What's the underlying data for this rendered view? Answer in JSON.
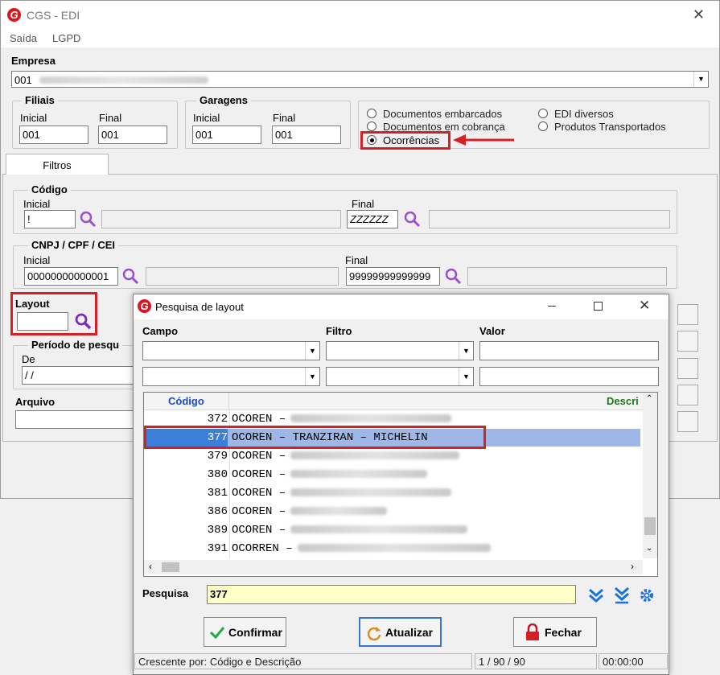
{
  "window": {
    "title": "CGS - EDI",
    "close": "✕"
  },
  "menu": [
    "Saída",
    "LGPD"
  ],
  "empresa": {
    "label": "Empresa",
    "value": "001"
  },
  "filiais": {
    "title": "Filiais",
    "inicial_label": "Inicial",
    "inicial": "001",
    "final_label": "Final",
    "final": "001"
  },
  "garagens": {
    "title": "Garagens",
    "inicial_label": "Inicial",
    "inicial": "001",
    "final_label": "Final",
    "final": "001"
  },
  "options": {
    "docs_embarcados": "Documentos embarcados",
    "docs_cobranca": "Documentos em cobrança",
    "ocorrencias": "Ocorrências",
    "edi_diversos": "EDI diversos",
    "produtos": "Produtos Transportados",
    "selected": "ocorrencias"
  },
  "tabs": {
    "filtros": "Filtros"
  },
  "codigo": {
    "title": "Código",
    "inicial_label": "Inicial",
    "inicial": "!",
    "final_label": "Final",
    "final": "ZZZZZZ"
  },
  "cnpj": {
    "title": "CNPJ / CPF / CEI",
    "inicial_label": "Inicial",
    "inicial": "00000000000001",
    "final_label": "Final",
    "final": "99999999999999"
  },
  "layout": {
    "label": "Layout",
    "value": ""
  },
  "periodo": {
    "title": "Período de pesqu",
    "de_label": "De",
    "de": " / /"
  },
  "arquivo": {
    "label": "Arquivo"
  },
  "dialog": {
    "title": "Pesquisa de layout",
    "campo_label": "Campo",
    "filtro_label": "Filtro",
    "valor_label": "Valor",
    "col_codigo": "Código",
    "col_descricao": "Descri",
    "rows": [
      {
        "code": "372",
        "desc": "OCOREN –",
        "selected": false
      },
      {
        "code": "377",
        "desc": "OCOREN – TRANZIRAN – MICHELIN",
        "selected": true
      },
      {
        "code": "379",
        "desc": "OCOREN –",
        "selected": false
      },
      {
        "code": "380",
        "desc": "OCOREN –",
        "selected": false
      },
      {
        "code": "381",
        "desc": "OCOREN –",
        "selected": false
      },
      {
        "code": "386",
        "desc": "OCOREN –",
        "selected": false
      },
      {
        "code": "389",
        "desc": "OCOREN –",
        "selected": false
      },
      {
        "code": "391",
        "desc": "OCORREN –",
        "selected": false
      }
    ],
    "pesquisa_label": "Pesquisa",
    "pesquisa_value": "377",
    "confirmar": "Confirmar",
    "atualizar": "Atualizar",
    "fechar": "Fechar",
    "status_sort": "Crescente por: Código e Descrição",
    "status_count": "1 / 90 / 90",
    "status_time": "00:00:00"
  },
  "colors": {
    "accent": "#d42027",
    "selection": "#9fb7e6",
    "selection_code": "#3d7fd8",
    "search_bg": "#ffffc8",
    "icon_blue": "#1a73d9",
    "purple": "#7a2fb8"
  }
}
